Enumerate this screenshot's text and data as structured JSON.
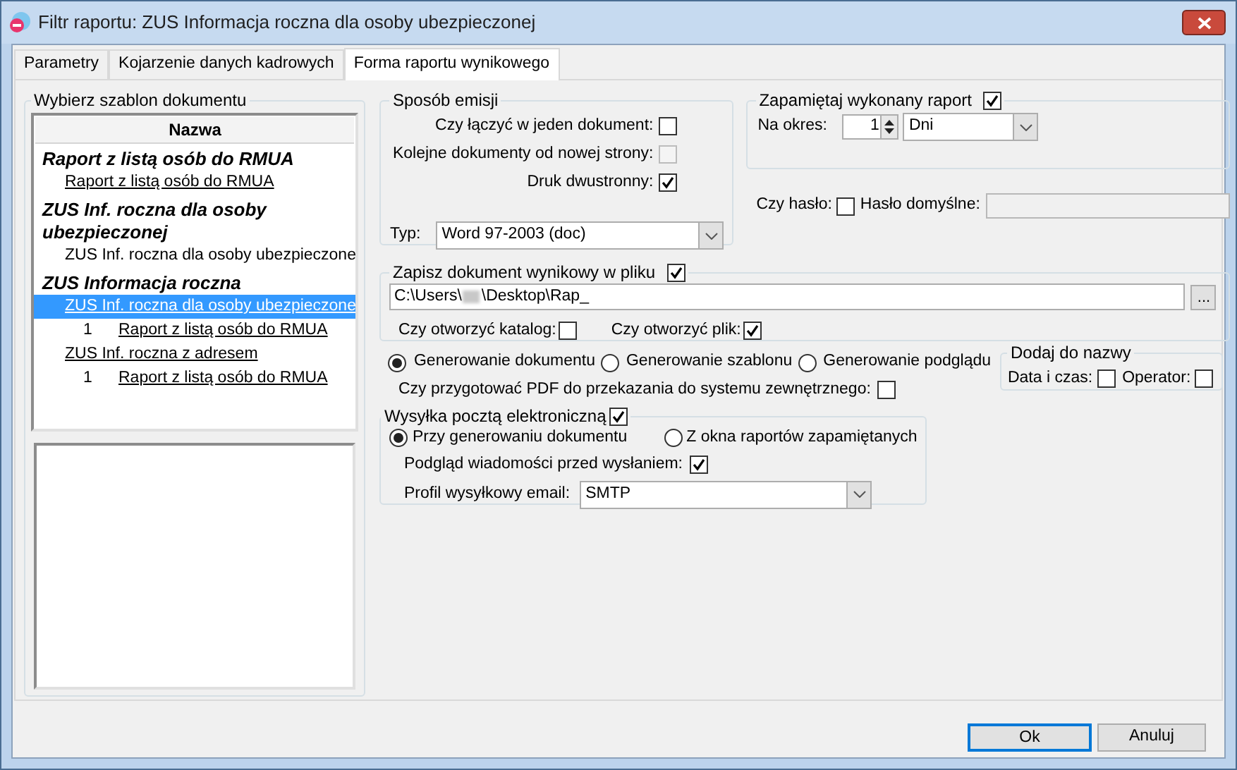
{
  "window": {
    "title": "Filtr raportu: ZUS Informacja roczna dla osoby ubezpieczonej"
  },
  "tabs": [
    {
      "label": "Parametry",
      "selected": false
    },
    {
      "label": "Kojarzenie danych kadrowych",
      "selected": false
    },
    {
      "label": "Forma raportu wynikowego",
      "selected": true
    }
  ],
  "template_panel": {
    "title": "Wybierz szablon dokumentu",
    "column": "Nazwa",
    "tree": [
      {
        "label": "Raport z listą osób do RMUA",
        "children": [
          {
            "label": "Raport z listą osób do RMUA",
            "linked": true,
            "selected": false
          }
        ]
      },
      {
        "label": "ZUS Inf. roczna dla osoby ubezpieczonej",
        "children": [
          {
            "label": "ZUS Inf. roczna dla osoby ubezpieczone",
            "linked": false,
            "selected": false
          }
        ]
      },
      {
        "label": "ZUS Informacja roczna",
        "children": [
          {
            "label": "ZUS Inf. roczna dla osoby ubezpieczone",
            "linked": true,
            "selected": true,
            "children": [
              {
                "number": "1",
                "label": "Raport z listą osób do RMUA"
              }
            ]
          },
          {
            "label": "ZUS Inf. roczna z adresem",
            "linked": true,
            "selected": false,
            "children": [
              {
                "number": "1",
                "label": "Raport z listą osób do RMUA"
              }
            ]
          }
        ]
      }
    ]
  },
  "emission": {
    "title": "Sposób emisji",
    "options": [
      {
        "label": "Czy łączyć w jeden dokument:",
        "checked": false,
        "disabled": false
      },
      {
        "label": "Kolejne dokumenty od nowej strony:",
        "checked": false,
        "disabled": true
      },
      {
        "label": "Druk dwustronny:",
        "checked": true,
        "disabled": false
      }
    ],
    "type_label": "Typ:",
    "type_value": "Word 97-2003 (doc)"
  },
  "remember": {
    "title": "Zapamiętaj wykonany raport",
    "checked": true,
    "period_label": "Na okres:",
    "period_value": "1",
    "unit": "Dni"
  },
  "password": {
    "label": "Czy hasło:",
    "checked": false,
    "default_label": "Hasło domyślne:"
  },
  "save_file": {
    "title": "Zapisz dokument wynikowy w pliku",
    "checked": true,
    "path_start": "C:\\Users\\",
    "path_end": "\\Desktop\\Rap_",
    "browse": "...",
    "options": [
      {
        "label": "Czy otworzyć katalog:",
        "checked": false
      },
      {
        "label": "Czy otworzyć plik:",
        "checked": true
      }
    ]
  },
  "generation": [
    {
      "label": "Generowanie dokumentu",
      "selected": true
    },
    {
      "label": "Generowanie szablonu",
      "selected": false
    },
    {
      "label": "Generowanie podglądu",
      "selected": false
    }
  ],
  "pdf": {
    "label": "Czy przygotować PDF do przekazania do systemu zewnętrznego:",
    "checked": false
  },
  "add_to_name": {
    "title": "Dodaj do nazwy",
    "options": [
      {
        "label": "Data i czas:",
        "checked": false
      },
      {
        "label": "Operator:",
        "checked": false
      }
    ]
  },
  "email": {
    "title": "Wysyłka pocztą elektroniczną",
    "checked": true,
    "modes": [
      {
        "label": "Przy generowaniu dokumentu",
        "selected": true
      },
      {
        "label": "Z okna raportów zapamiętanych",
        "selected": false
      }
    ],
    "preview": {
      "label": "Podgląd wiadomości przed wysłaniem:",
      "checked": true
    },
    "profile_label": "Profil wysyłkowy email:",
    "profile_value": "SMTP"
  },
  "buttons": [
    {
      "label": "Ok",
      "default": true
    },
    {
      "label": "Anuluj",
      "default": false
    }
  ]
}
